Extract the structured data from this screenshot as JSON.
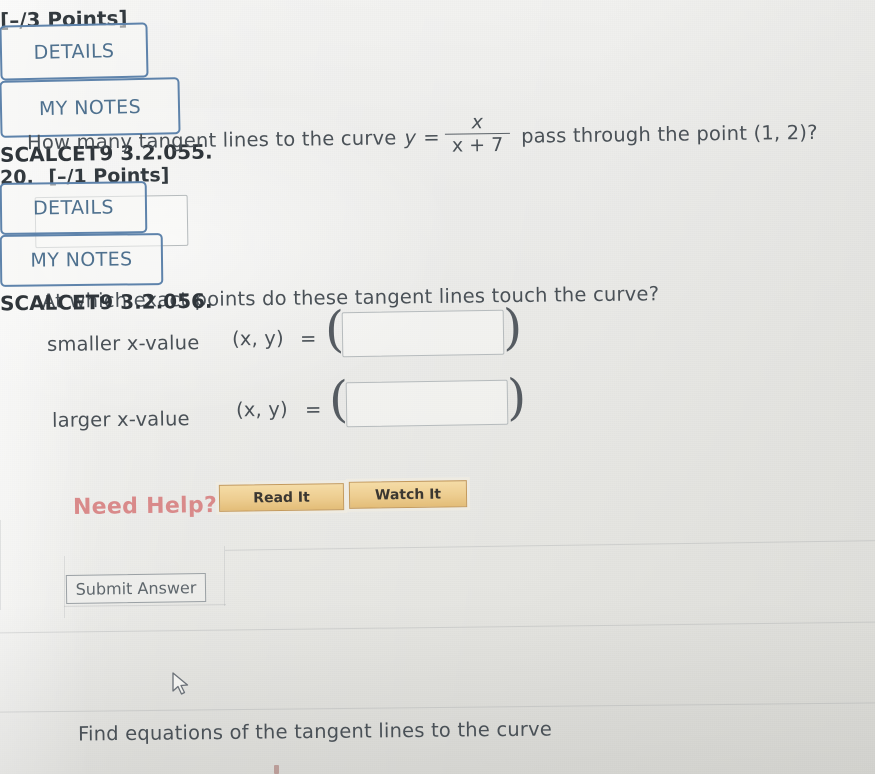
{
  "problem1": {
    "points_label": "[–/3 Points]",
    "details_button": "DETAILS",
    "my_notes_button": "MY NOTES",
    "reference": "SCALCET9 3.2.055.",
    "question_prefix": "How many tangent lines to the curve",
    "equation": {
      "lhs": "y",
      "equals": "=",
      "numerator": "x",
      "denominator": "x + 7"
    },
    "question_suffix": "pass through the point (1, 2)?",
    "count_answer_value": "",
    "subquestion": "At which exact points do these tangent lines touch the curve?",
    "rows": [
      {
        "label": "smaller x-value",
        "coord_label": "(x, y)",
        "equals": "=",
        "open_paren": "(",
        "close_paren": ")",
        "value": ""
      },
      {
        "label": "larger x-value",
        "coord_label": "(x, y)",
        "equals": "=",
        "open_paren": "(",
        "close_paren": ")",
        "value": ""
      }
    ],
    "need_help_label": "Need Help?",
    "read_it_button": "Read It",
    "watch_it_button": "Watch It",
    "submit_button": "Submit Answer"
  },
  "problem2": {
    "number": "20.",
    "points_label": "[–/1 Points]",
    "details_button": "DETAILS",
    "my_notes_button": "MY NOTES",
    "reference": "SCALCET9 3.2.056.",
    "question_prefix": "Find equations of the tangent lines to the curve"
  },
  "colors": {
    "page_background": "#e9e9e6",
    "nav_button_border": "#5e83ab",
    "nav_button_text": "#4f718f",
    "body_text": "#4a5157",
    "heading_text": "#2f353a",
    "need_help_text": "#d98a8a",
    "help_button_fill": "#edcd90",
    "help_button_border": "#c49a5c",
    "input_border": "#b6bbbd"
  },
  "icons": {
    "cursor": "mouse-pointer-arrow"
  }
}
